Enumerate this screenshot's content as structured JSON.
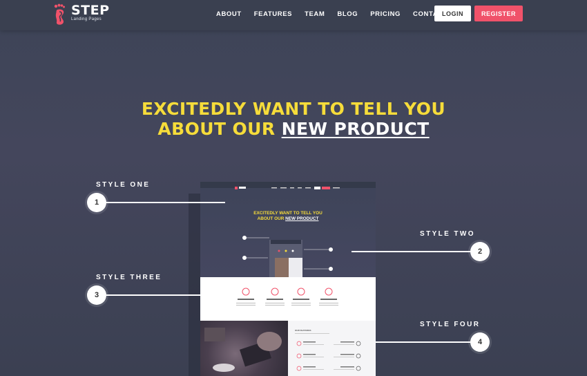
{
  "brand": {
    "name": "STEP",
    "tagline": "Landing Pages",
    "accent_color": "#f0526a",
    "headline_color": "#f6dc3a",
    "logo_icon": "footprint-icon"
  },
  "nav": {
    "items": [
      "ABOUT",
      "FEATURES",
      "TEAM",
      "BLOG",
      "PRICING",
      "CONTACT"
    ],
    "login": "LOGIN",
    "register": "REGISTER"
  },
  "hero": {
    "line1": "EXCITEDLY WANT TO TELL YOU",
    "line2_prefix": "ABOUT OUR ",
    "line2_highlight": "NEW PRODUCT"
  },
  "styles": [
    {
      "label": "STYLE ONE",
      "number": "1"
    },
    {
      "label": "STYLE TWO",
      "number": "2"
    },
    {
      "label": "STYLE THREE",
      "number": "3"
    },
    {
      "label": "STYLE FOUR",
      "number": "4"
    }
  ],
  "mockup": {
    "features_title": "OUR FEATURES"
  }
}
